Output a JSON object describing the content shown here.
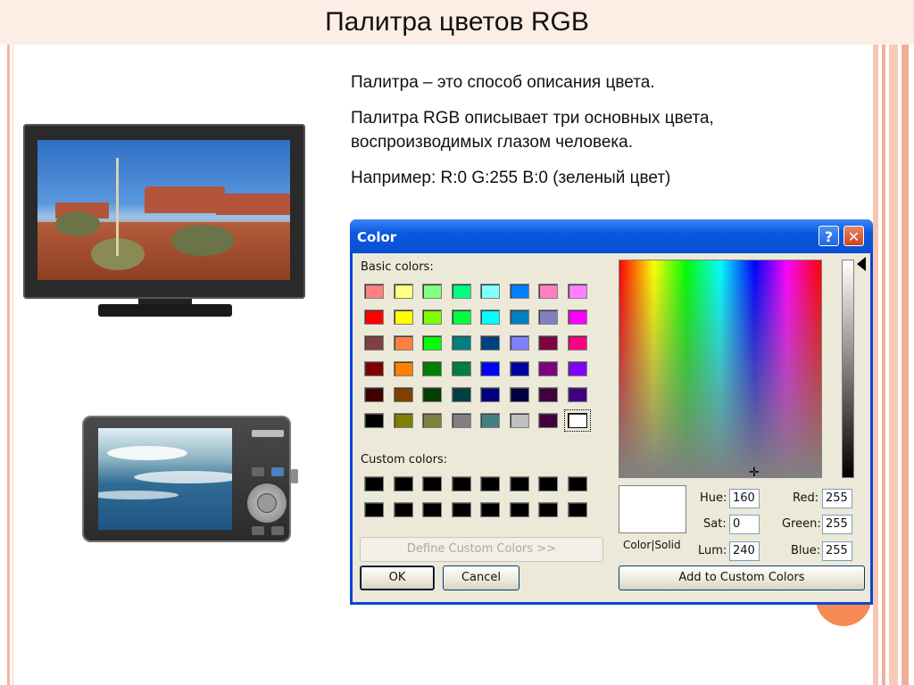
{
  "slide": {
    "title": "Палитра цветов RGB",
    "paragraphs": [
      "Палитра – это способ описания цвета.",
      "Палитра RGB описывает три основных цвета,",
      "воспроизводимых глазом человека.",
      "Например: R:0 G:255 B:0 (зеленый цвет)"
    ]
  },
  "dialog": {
    "title": "Color",
    "help_label": "?",
    "close_label": "✕",
    "basic_colors_label": "Basic colors:",
    "custom_colors_label": "Custom colors:",
    "basic_colors": [
      [
        "#ff8080",
        "#ffff80",
        "#80ff80",
        "#00ff80",
        "#80ffff",
        "#0080ff",
        "#ff80c0",
        "#ff80ff"
      ],
      [
        "#ff0000",
        "#ffff00",
        "#80ff00",
        "#00ff40",
        "#00ffff",
        "#0080c0",
        "#8080c0",
        "#ff00ff"
      ],
      [
        "#804040",
        "#ff8040",
        "#00ff00",
        "#008080",
        "#004080",
        "#8080ff",
        "#800040",
        "#ff0080"
      ],
      [
        "#800000",
        "#ff8000",
        "#008000",
        "#008040",
        "#0000ff",
        "#0000a0",
        "#800080",
        "#8000ff"
      ],
      [
        "#400000",
        "#804000",
        "#004000",
        "#004040",
        "#000080",
        "#000040",
        "#400040",
        "#400080"
      ],
      [
        "#000000",
        "#808000",
        "#808040",
        "#808080",
        "#408080",
        "#c0c0c0",
        "#400040",
        "#ffffff"
      ]
    ],
    "selected_basic_color": "#ffffff",
    "custom_colors": [
      [
        "#000000",
        "#000000",
        "#000000",
        "#000000",
        "#000000",
        "#000000",
        "#000000",
        "#000000"
      ],
      [
        "#000000",
        "#000000",
        "#000000",
        "#000000",
        "#000000",
        "#000000",
        "#000000",
        "#000000"
      ]
    ],
    "define_custom_label": "Define Custom Colors >>",
    "ok_label": "OK",
    "cancel_label": "Cancel",
    "color_solid_label": "Color|Solid",
    "hue_label": "Hue:",
    "sat_label": "Sat:",
    "lum_label": "Lum:",
    "red_label": "Red:",
    "green_label": "Green:",
    "blue_label": "Blue:",
    "hue": "160",
    "sat": "0",
    "lum": "240",
    "red": "255",
    "green": "255",
    "blue": "255",
    "add_custom_label": "Add to Custom Colors",
    "preview_color": "#ffffff"
  },
  "icons": {
    "tv": "tv-image",
    "camera": "camera-image",
    "crosshair": "crosshair-icon",
    "luminance_pointer": "triangle-left-icon"
  }
}
